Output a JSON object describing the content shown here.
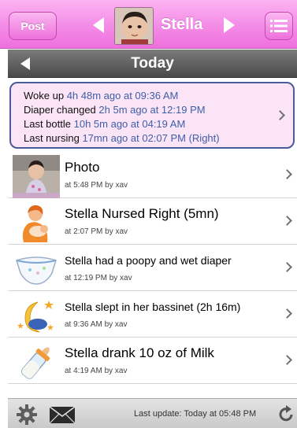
{
  "header": {
    "post_label": "Post",
    "baby_name": "Stella"
  },
  "datebar": {
    "title": "Today"
  },
  "summary": [
    {
      "label": "Woke up",
      "value": "4h 48m ago at 09:36 AM"
    },
    {
      "label": "Diaper changed",
      "value": "2h 5m ago at 12:19 PM"
    },
    {
      "label": "Last bottle",
      "value": "10h 5m ago at 04:19 AM"
    },
    {
      "label": "Last nursing",
      "value": "17mn ago at 02:07 PM (Right)"
    }
  ],
  "events": [
    {
      "title": "Photo",
      "sub": "at 5:48 PM by xav",
      "icon": "photo-thumbnail"
    },
    {
      "title": "Stella Nursed Right (5mn)",
      "sub": "at 2:07 PM by xav",
      "icon": "nursing-icon"
    },
    {
      "title": "Stella had a poopy and wet diaper",
      "sub": "at 12:19 PM by xav",
      "icon": "diaper-icon"
    },
    {
      "title": "Stella slept in her bassinet (2h 16m)",
      "sub": "at 9:36 AM by xav",
      "icon": "moon-stars-icon"
    },
    {
      "title": "Stella drank 10 oz of Milk",
      "sub": "at 4:19 AM by xav",
      "icon": "baby-bottle-icon"
    }
  ],
  "footer": {
    "last_update": "Last update: Today at 05:48 PM"
  },
  "colors": {
    "pink_bar": "#ee6fdd",
    "summary_bg": "#fbe4f6",
    "summary_border": "#4a5a9a",
    "value_text": "#3d5fa8"
  }
}
